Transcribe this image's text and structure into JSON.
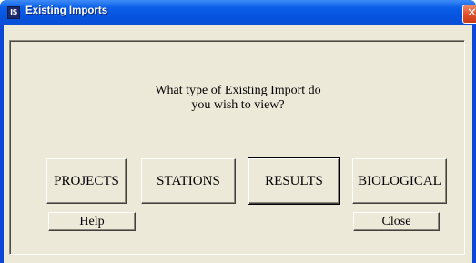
{
  "window": {
    "title": "Existing Imports",
    "app_icon_text": "IS"
  },
  "dialog": {
    "question_line1": "What type of Existing Import do",
    "question_line2": "you wish to view?",
    "buttons": {
      "projects": "PROJECTS",
      "stations": "STATIONS",
      "results": "RESULTS",
      "biological": "BIOLOGICAL",
      "help": "Help",
      "close": "Close"
    }
  },
  "colors": {
    "titlebar": "#0554e0",
    "face": "#ece9d8",
    "close_button": "#e2502a"
  }
}
